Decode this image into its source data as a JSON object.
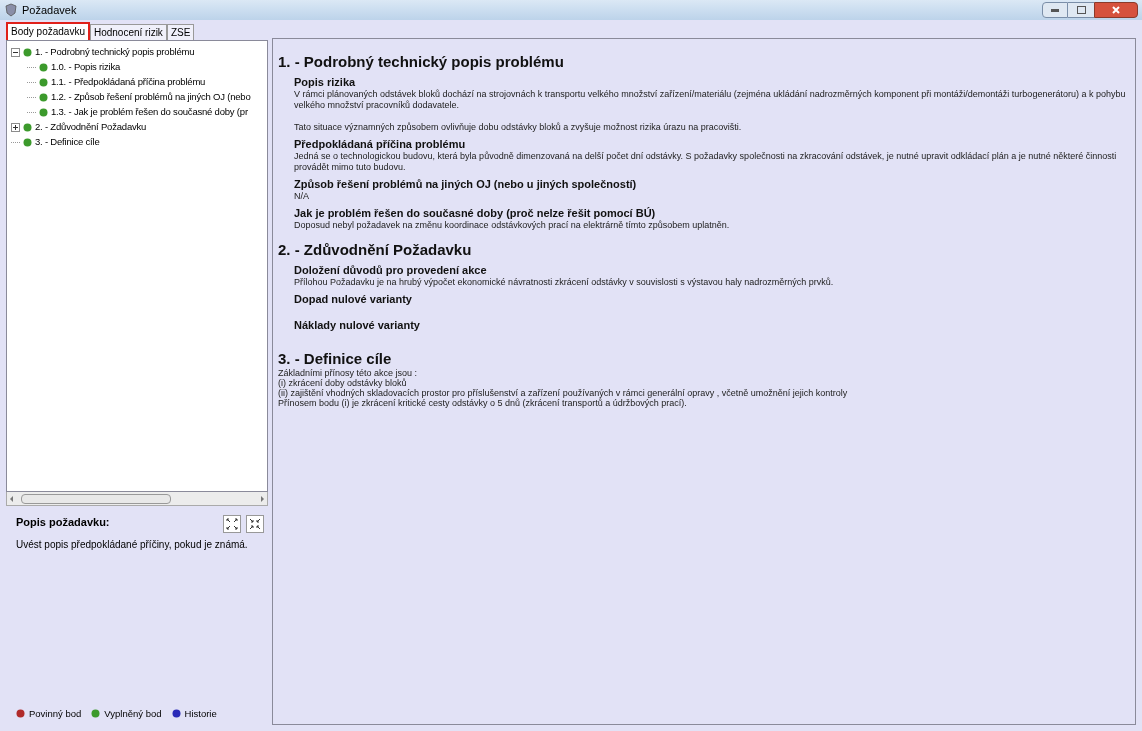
{
  "window": {
    "title": "Požadavek"
  },
  "tabs": [
    {
      "label": "Body požadavku",
      "selected": true
    },
    {
      "label": "Hodnocení rizik",
      "selected": false
    },
    {
      "label": "ZSE",
      "selected": false
    }
  ],
  "tree": [
    {
      "label": "1. - Podrobný technický popis problému",
      "color": "#3c9a2c",
      "expanded": true,
      "children": [
        {
          "label": "1.0. - Popis rizika",
          "color": "#3c9a2c"
        },
        {
          "label": "1.1. - Předpokládaná příčina problému",
          "color": "#3c9a2c"
        },
        {
          "label": "1.2. - Způsob řešení problémů na jiných OJ (nebo",
          "color": "#3c9a2c"
        },
        {
          "label": "1.3. - Jak je problém  řešen do současné doby (pr",
          "color": "#3c9a2c"
        }
      ]
    },
    {
      "label": "2. - Zdůvodnění Požadavku",
      "color": "#3c9a2c",
      "expanded": false
    },
    {
      "label": "3. - Definice cíle",
      "color": "#3c9a2c"
    }
  ],
  "description": {
    "title": "Popis požadavku:",
    "text": "Uvést popis předpokládané příčiny, pokud je známá."
  },
  "legend": [
    {
      "label": "Povinný bod",
      "color": "#b02a2a"
    },
    {
      "label": "Vyplněný bod",
      "color": "#3c9a2c"
    },
    {
      "label": "Historie",
      "color": "#2a2ab8"
    }
  ],
  "sections": [
    {
      "title": "1. - Podrobný technický popis problému",
      "items": [
        {
          "heading": "Popis rizika",
          "paragraphs": [
            "V rámci plánovaných odstávek bloků  dochází na strojovnách  k transportu velkého množství zařízení/materiálu (zejména ukládání nadrozměrných komponent při montáži/demontáži turbogenerátoru) a k pohybu velkého množství pracovníků dodavatele.",
            "Tato situace významných způsobem ovlivňuje dobu odstávky bloků a zvyšuje možnost rizika úrazu na pracovišti."
          ]
        },
        {
          "heading": "Předpokládaná příčina problému",
          "paragraphs": [
            "Jedná se o technologickou budovu, která byla původně dimenzovaná na delší počet dní odstávky. S požadavky společnosti  na zkracování odstávek, je nutné upravit odkládací plán a je nutné některé činnosti provádět mimo tuto budovu."
          ]
        },
        {
          "heading": "Způsob řešení problémů na jiných OJ (nebo u jiných společností)",
          "paragraphs": [
            "N/A"
          ]
        },
        {
          "heading": "Jak je problém  řešen do současné doby (proč nelze řešit pomocí BÚ)",
          "paragraphs": [
            "Doposud nebyl požadavek na změnu koordinace odstávkových prací na elektrárně tímto způsobem uplatněn."
          ]
        }
      ]
    },
    {
      "title": "2. - Zdůvodnění Požadavku",
      "items": [
        {
          "heading": "Doložení důvodů pro provedení akce",
          "paragraphs": [
            "Přílohou Požadavku je  na hrubý výpočet ekonomické návratnosti zkrácení odstávky v souvislosti s výstavou haly nadrozměrných prvků."
          ]
        },
        {
          "heading": "Dopad nulové varianty"
        },
        {
          "heading": "Náklady nulové varianty"
        }
      ]
    },
    {
      "title": "3. - Definice cíle",
      "lines": [
        "Základními přínosy této akce jsou :",
        "(i) zkrácení doby odstávky bloků",
        "(ii) zajištění vhodných skladovacích prostor  pro příslušenství a zařízení používaných v rámci generální opravy , včetně umožnění jejich kontroly",
        "Přínosem bodu (i) je zkrácení kritické cesty odstávky o 5 dnů (zkrácení transportů a údržbových prací)."
      ]
    }
  ]
}
